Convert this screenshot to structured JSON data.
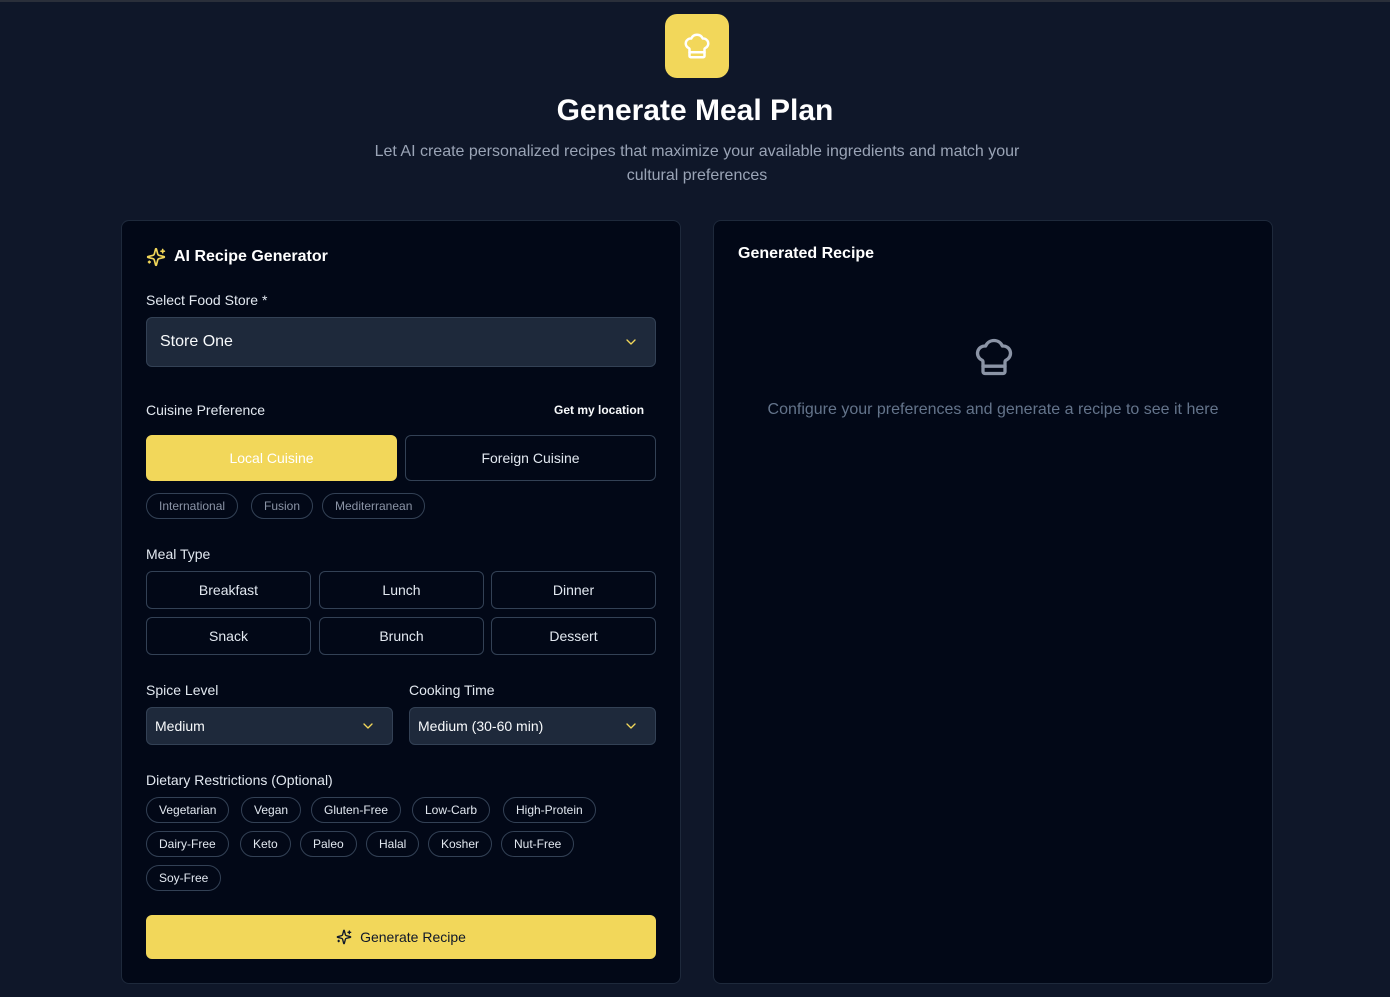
{
  "header": {
    "title": "Generate Meal Plan",
    "subtitle": "Let AI create personalized recipes that maximize your available ingredients and match your cultural preferences"
  },
  "generator": {
    "title": "AI Recipe Generator",
    "store_label": "Select Food Store *",
    "store_value": "Store One",
    "cuisine_label": "Cuisine Preference",
    "location_link": "Get my location",
    "cuisine_options": [
      "Local Cuisine",
      "Foreign Cuisine"
    ],
    "cuisine_selected": "Local Cuisine",
    "cuisine_tags": [
      "International",
      "Fusion",
      "Mediterranean"
    ],
    "meal_type_label": "Meal Type",
    "meal_types": [
      "Breakfast",
      "Lunch",
      "Dinner",
      "Snack",
      "Brunch",
      "Dessert"
    ],
    "spice_label": "Spice Level",
    "spice_value": "Medium",
    "time_label": "Cooking Time",
    "time_value": "Medium (30-60 min)",
    "dietary_label": "Dietary Restrictions (Optional)",
    "dietary_options": [
      "Vegetarian",
      "Vegan",
      "Gluten-Free",
      "Low-Carb",
      "High-Protein",
      "Dairy-Free",
      "Keto",
      "Paleo",
      "Halal",
      "Kosher",
      "Nut-Free",
      "Soy-Free"
    ],
    "generate_label": "Generate Recipe"
  },
  "result": {
    "title": "Generated Recipe",
    "empty_text": "Configure your preferences and generate a recipe to see it here"
  },
  "colors": {
    "accent": "#f2d75a",
    "background": "#0f1729",
    "card": "#020817",
    "border": "#334155"
  },
  "icons": {
    "logo": "chef-hat-icon",
    "generator": "sparkles-icon",
    "dropdown": "chevron-down-icon",
    "empty_state": "chef-hat-icon"
  }
}
